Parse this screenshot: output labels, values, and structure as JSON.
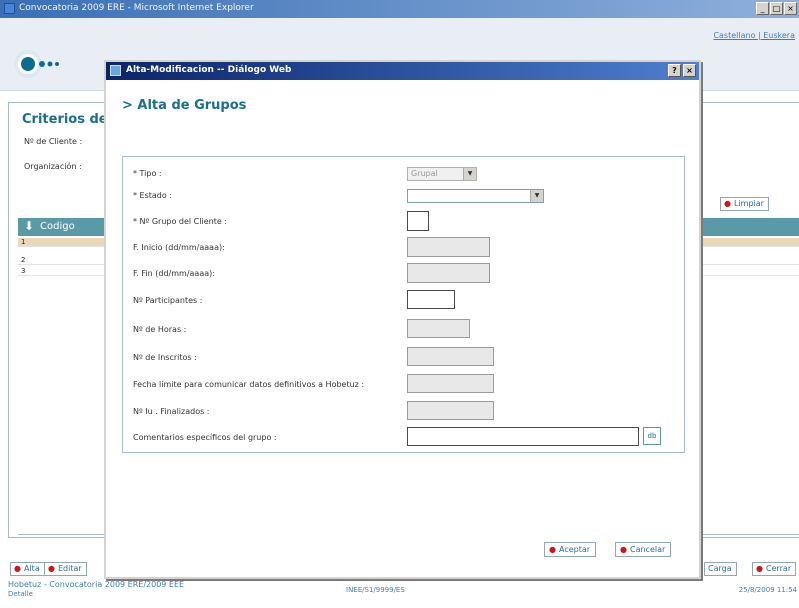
{
  "window": {
    "title": "Convocatoria 2009 ERE - Microsoft Internet Explorer",
    "controls": [
      "_",
      "□",
      "×"
    ]
  },
  "header": {
    "lang_links": "Castellano | Euskera"
  },
  "background": {
    "criterios_title": "Criterios de",
    "labels": [
      "Nº de Cliente :",
      "Organización :"
    ],
    "grid_header": "Codigo",
    "grid_rows": [
      "1",
      "2",
      "3"
    ],
    "limpiar_label": "Limpiar",
    "alta_label": "Alta",
    "editar_label": "Editar",
    "carga_label": "Carga",
    "cerrar_label": "Cerrar",
    "footer_app": "Hobetuz - Convocatoria 2009 ERE/2009 EEE",
    "footer_detail": "Detalle",
    "footer_code": "INEE/S1/9999/ES",
    "footer_date": "25/8/2009 11:54"
  },
  "dialog": {
    "title": "Alta-Modificacion -- Diálogo Web",
    "controls": [
      "?",
      "×"
    ],
    "heading": "> Alta de Grupos",
    "fields": {
      "tipo": {
        "label": "* Tipo :",
        "value": "Grupal"
      },
      "estado": {
        "label": "* Estado :",
        "value": ""
      },
      "num_grupo": {
        "label": "* Nº Grupo del Cliente :"
      },
      "f_inicio": {
        "label": "F. Inicio (dd/mm/aaaa):"
      },
      "f_fin": {
        "label": "F. Fin (dd/mm/aaaa):"
      },
      "num_participantes": {
        "label": "Nº Participantes :"
      },
      "num_horas": {
        "label": "Nº de Horas :"
      },
      "num_inscritos": {
        "label": "Nº de Inscritos :"
      },
      "fecha_limite": {
        "label": "Fecha límite para comunicar datos definitivos a Hobetuz :"
      },
      "num_finalizados": {
        "label": "Nº Iu . Finalizados :"
      },
      "comentarios": {
        "label": "Comentarios específicos del grupo :",
        "button": "db"
      }
    },
    "aceptar_label": "Aceptar",
    "cancelar_label": "Cancelar"
  },
  "colors": {
    "accent": "#1a6e8e",
    "grid_header": "#5a9aa8",
    "dialog_title": "#0a246a",
    "button_dot": "#d01515"
  }
}
